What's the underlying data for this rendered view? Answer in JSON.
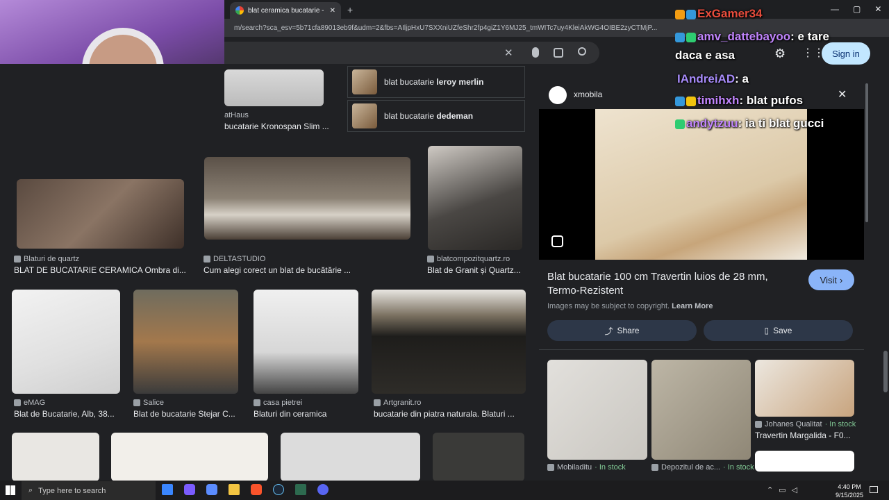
{
  "browser": {
    "tab_title": "blat ceramica bucatarie - Google",
    "url": "m/search?sca_esv=5b71cfa89013eb9f&udm=2&fbs=AIljpHxU7SXXniUZfeShr2fp4giZ1Y6MJ25_tmWITc7uy4KleiAkWG4OIBE2zyCTMjP...",
    "sign_in": "Sign in"
  },
  "related": [
    {
      "label_prefix": "blat bucatarie ",
      "label_bold": "leroy merlin"
    },
    {
      "label_prefix": "blat bucatarie ",
      "label_bold": "dedeman"
    }
  ],
  "results": [
    {
      "source": "atHaus",
      "title": "bucatarie Kronospan Slim ..."
    },
    {
      "source": "Blaturi de quartz",
      "title": "BLAT DE BUCATARIE CERAMICA Ombra di..."
    },
    {
      "source": "DELTASTUDIO",
      "title": "Cum alegi corect un blat de bucătărie ..."
    },
    {
      "source": "blatcompozitquartz.ro",
      "title": "Blat de Granit și Quartz..."
    },
    {
      "source": "eMAG",
      "title": "Blat de Bucatarie, Alb, 38..."
    },
    {
      "source": "Salice",
      "title": "Blat de bucatarie Stejar C..."
    },
    {
      "source": "casa pietrei",
      "title": "Blaturi din ceramica"
    },
    {
      "source": "Artgranit.ro",
      "title": "bucatarie din piatra naturala. Blaturi ..."
    }
  ],
  "panel": {
    "site": "xmobila",
    "title": "Blat bucatarie 100 cm Travertin luios de 28 mm, Termo-Rezistent",
    "visit": "Visit",
    "copyright": "Images may be subject to copyright.",
    "learn_more": "Learn More",
    "share": "Share",
    "save": "Save",
    "similar": [
      {
        "source": "Mobiladitu",
        "stock": "In stock",
        "title": ""
      },
      {
        "source": "Depozitul de ac...",
        "stock": "In stock",
        "title": ""
      },
      {
        "source": "Johanes Qualitat",
        "stock": "In stock",
        "title": "Travertin Margalida - F0..."
      }
    ]
  },
  "chat": [
    {
      "user": "ExGamer34",
      "msg": ""
    },
    {
      "user": "amv_dattebayoo",
      "msg": ": e tare"
    },
    {
      "user": "",
      "msg": "daca e asa"
    },
    {
      "user": "IAndreiAD",
      "msg": ": a"
    },
    {
      "user": "timihxh",
      "msg": ": blat pufos"
    },
    {
      "user": "andytzuu",
      "msg": ": ia ti blat gucci"
    }
  ],
  "taskbar": {
    "search_placeholder": "Type here to search",
    "time": "4:40 PM",
    "date": "9/15/2025"
  }
}
